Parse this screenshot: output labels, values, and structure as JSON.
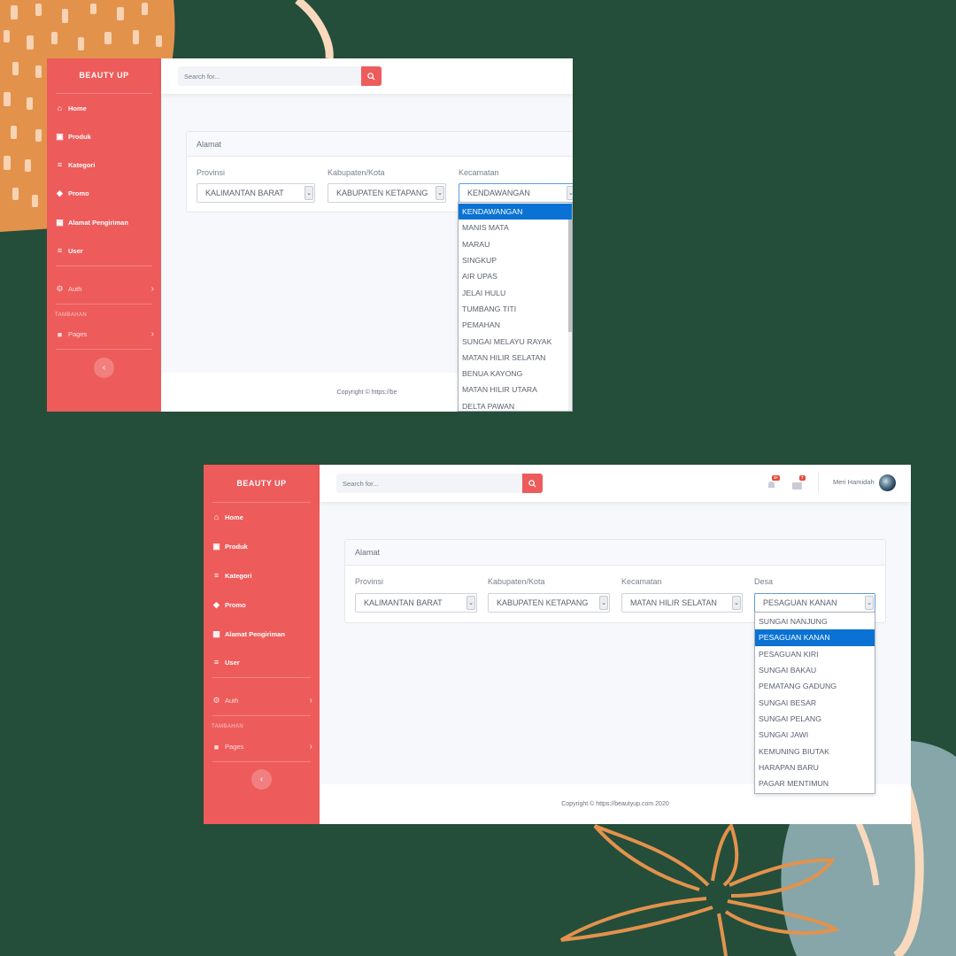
{
  "theme": {
    "accent": "#ee5b5b",
    "background": "#244d3a",
    "selected_option": "#0a72d4"
  },
  "screen1": {
    "brand": "BEAUTY UP",
    "nav": [
      {
        "label": "Home",
        "icon": "home-icon"
      },
      {
        "label": "Produk",
        "icon": "cart-icon"
      },
      {
        "label": "Kategori",
        "icon": "list-icon"
      },
      {
        "label": "Promo",
        "icon": "tags-icon"
      },
      {
        "label": "Alamat Pengiriman",
        "icon": "address-card-icon"
      },
      {
        "label": "User",
        "icon": "list-icon"
      }
    ],
    "auth_label": "Auth",
    "section_label": "TAMBAHAN",
    "pages_label": "Pages",
    "search_placeholder": "Search for...",
    "card_title": "Alamat",
    "fields": [
      {
        "label": "Provinsi",
        "value": "KALIMANTAN BARAT"
      },
      {
        "label": "Kabupaten/Kota",
        "value": "KABUPATEN KETAPANG"
      },
      {
        "label": "Kecamatan",
        "value": "KENDAWANGAN"
      }
    ],
    "dropdown_options": [
      "KENDAWANGAN",
      "MANIS MATA",
      "MARAU",
      "SINGKUP",
      "AIR UPAS",
      "JELAI HULU",
      "TUMBANG TITI",
      "PEMAHAN",
      "SUNGAI MELAYU RAYAK",
      "MATAN HILIR SELATAN",
      "BENUA KAYONG",
      "MATAN HILIR UTARA",
      "DELTA PAWAN"
    ],
    "selected_option": "KENDAWANGAN",
    "footer": "Copyright © https://be"
  },
  "screen2": {
    "brand": "BEAUTY UP",
    "nav": [
      {
        "label": "Home",
        "icon": "home-icon"
      },
      {
        "label": "Produk",
        "icon": "cart-icon"
      },
      {
        "label": "Kategori",
        "icon": "list-icon"
      },
      {
        "label": "Promo",
        "icon": "tags-icon"
      },
      {
        "label": "Alamat Pengiriman",
        "icon": "address-card-icon"
      },
      {
        "label": "User",
        "icon": "list-icon"
      }
    ],
    "auth_label": "Auth",
    "section_label": "TAMBAHAN",
    "pages_label": "Pages",
    "search_placeholder": "Search for...",
    "alerts_badge": "3+",
    "messages_badge": "7",
    "user_name": "Meri Hamidah",
    "card_title": "Alamat",
    "fields": [
      {
        "label": "Provinsi",
        "value": "KALIMANTAN BARAT"
      },
      {
        "label": "Kabupaten/Kota",
        "value": "KABUPATEN KETAPANG"
      },
      {
        "label": "Kecamatan",
        "value": "MATAN HILIR SELATAN"
      },
      {
        "label": "Desa",
        "value": "PESAGUAN KANAN"
      }
    ],
    "dropdown_options": [
      "SUNGAI NANJUNG",
      "PESAGUAN KANAN",
      "PESAGUAN KIRI",
      "SUNGAI BAKAU",
      "PEMATANG GADUNG",
      "SUNGAI BESAR",
      "SUNGAI PELANG",
      "SUNGAI JAWI",
      "KEMUNING BIUTAK",
      "HARAPAN BARU",
      "PAGAR MENTIMUN"
    ],
    "selected_option": "PESAGUAN KANAN",
    "footer": "Copyright © https://beautyup.com 2020"
  }
}
